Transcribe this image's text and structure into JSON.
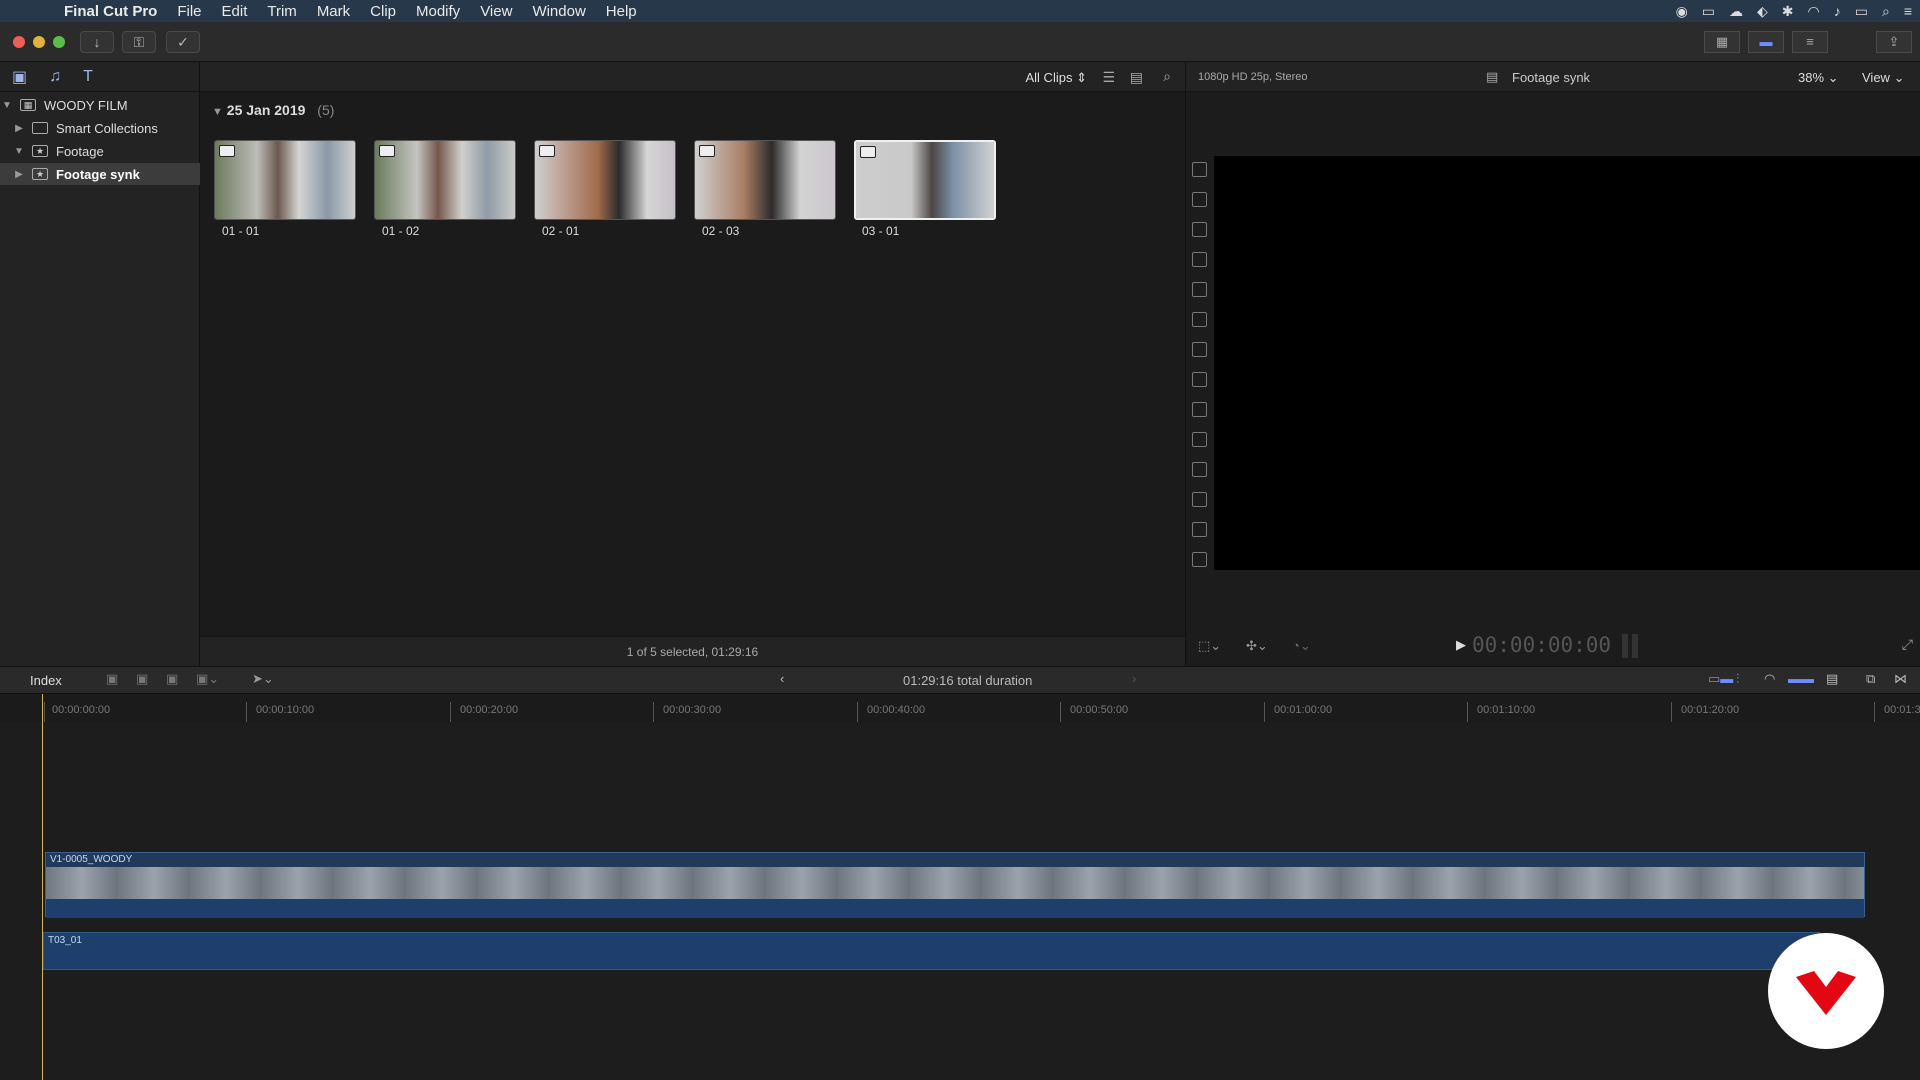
{
  "menubar": {
    "app_name": "Final Cut Pro",
    "menus": [
      "File",
      "Edit",
      "Trim",
      "Mark",
      "Clip",
      "Modify",
      "View",
      "Window",
      "Help"
    ]
  },
  "libraries": {
    "library_name": "WOODY FILM",
    "items": [
      {
        "label": "Smart Collections",
        "selected": false
      },
      {
        "label": "Footage",
        "selected": false
      },
      {
        "label": "Footage synk",
        "selected": true
      }
    ]
  },
  "browser": {
    "filter_label": "All Clips",
    "event_date": "25 Jan 2019",
    "event_count": "(5)",
    "clips": [
      {
        "label": "01 - 01"
      },
      {
        "label": "01 - 02"
      },
      {
        "label": "02 - 01"
      },
      {
        "label": "02 - 03"
      },
      {
        "label": "03 - 01",
        "selected": true
      }
    ],
    "status": "1 of 5 selected, 01:29:16"
  },
  "viewer": {
    "format": "1080p HD 25p, Stereo",
    "title": "Footage synk",
    "zoom": "38%",
    "view_menu": "View",
    "timecode": "00:00:00:00"
  },
  "timeline": {
    "index_label": "Index",
    "duration": "01:29:16 total duration",
    "ruler": [
      "00:00:00:00",
      "00:00:10:00",
      "00:00:20:00",
      "00:00:30:00",
      "00:00:40:00",
      "00:00:50:00",
      "00:01:00:00",
      "00:01:10:00",
      "00:01:20:00",
      "00:01:3"
    ],
    "video_clip_label": "V1-0005_WOODY",
    "audio_clip_label": "T03_01"
  },
  "colors": {
    "menubar": "#26384a",
    "clip_blue": "#223a5a",
    "playhead": "#d6b25a",
    "logo_red": "#e30613"
  }
}
